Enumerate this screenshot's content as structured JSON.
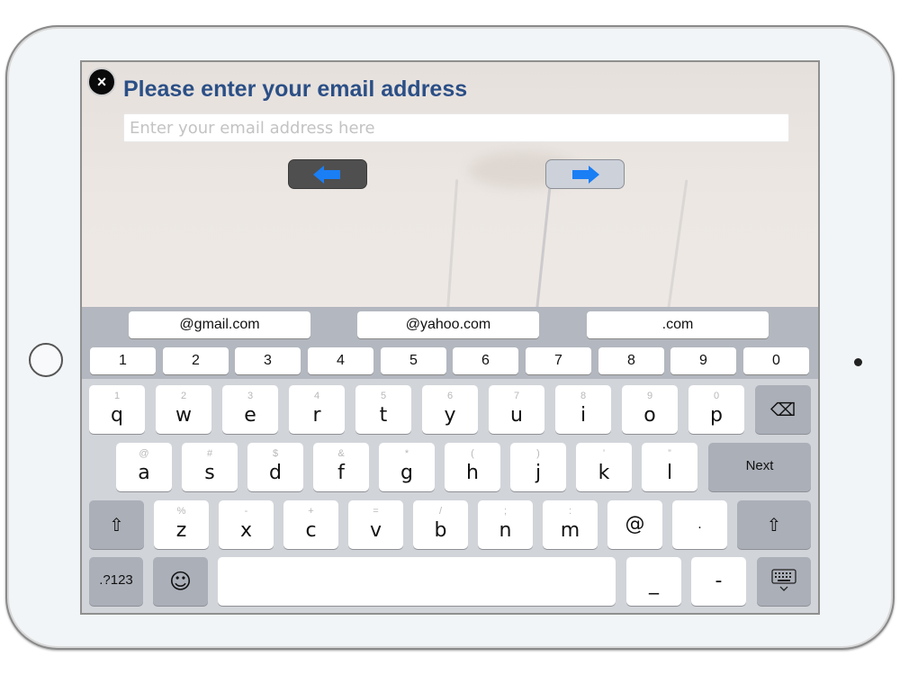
{
  "dialog": {
    "title": "Please enter your email address",
    "close_icon": "×",
    "email_input": {
      "value": "",
      "placeholder": "Enter your email address here"
    },
    "back_button_icon": "arrow-left-icon",
    "next_button_icon": "arrow-right-icon",
    "arrow_color": "#1a7ef5",
    "title_color": "#2b4f86"
  },
  "keyboard": {
    "suggestions": [
      "@gmail.com",
      "@yahoo.com",
      ".com"
    ],
    "number_row": [
      "1",
      "2",
      "3",
      "4",
      "5",
      "6",
      "7",
      "8",
      "9",
      "0"
    ],
    "row1": [
      {
        "main": "q",
        "alt": "1"
      },
      {
        "main": "w",
        "alt": "2"
      },
      {
        "main": "e",
        "alt": "3"
      },
      {
        "main": "r",
        "alt": "4"
      },
      {
        "main": "t",
        "alt": "5"
      },
      {
        "main": "y",
        "alt": "6"
      },
      {
        "main": "u",
        "alt": "7"
      },
      {
        "main": "i",
        "alt": "8"
      },
      {
        "main": "o",
        "alt": "9"
      },
      {
        "main": "p",
        "alt": "0"
      }
    ],
    "row2": [
      {
        "main": "a",
        "alt": "@"
      },
      {
        "main": "s",
        "alt": "#"
      },
      {
        "main": "d",
        "alt": "$"
      },
      {
        "main": "f",
        "alt": "&"
      },
      {
        "main": "g",
        "alt": "*"
      },
      {
        "main": "h",
        "alt": "("
      },
      {
        "main": "j",
        "alt": ")"
      },
      {
        "main": "k",
        "alt": "’"
      },
      {
        "main": "l",
        "alt": "”"
      }
    ],
    "row3": [
      {
        "main": "z",
        "alt": "%"
      },
      {
        "main": "x",
        "alt": "-"
      },
      {
        "main": "c",
        "alt": "+"
      },
      {
        "main": "v",
        "alt": "="
      },
      {
        "main": "b",
        "alt": "/"
      },
      {
        "main": "n",
        "alt": ";"
      },
      {
        "main": "m",
        "alt": ":"
      },
      {
        "main": "@",
        "alt": ""
      },
      {
        "main": ".",
        "alt": ""
      }
    ],
    "delete_icon": "⌫",
    "next_label": "Next",
    "shift_icon": "⇧",
    "numbers_label": ".?123",
    "emoji_icon": "☺",
    "underscore_key": "_",
    "dash_key": "-",
    "dismiss_icon": "keyboard-dismiss-icon"
  }
}
